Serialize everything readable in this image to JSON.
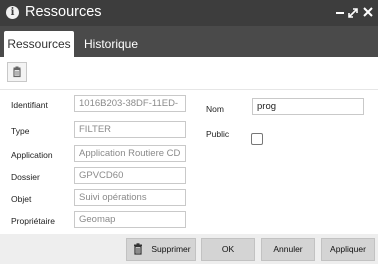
{
  "window": {
    "title": "Ressources"
  },
  "tabs": [
    {
      "label": "Ressources",
      "active": true
    },
    {
      "label": "Historique",
      "active": false
    }
  ],
  "fields": {
    "identifiant": {
      "label": "Identifiant",
      "value": "1016B203-38DF-11ED-"
    },
    "type": {
      "label": "Type",
      "value": "FILTER"
    },
    "application": {
      "label": "Application",
      "value": "Application Routiere CD"
    },
    "dossier": {
      "label": "Dossier",
      "value": "GPVCD60"
    },
    "objet": {
      "label": "Objet",
      "value": "Suivi opérations"
    },
    "proprietaire": {
      "label": "Propriétaire",
      "value": "Geomap"
    },
    "nom": {
      "label": "Nom",
      "value": "prog"
    },
    "public": {
      "label": "Public",
      "checked": false
    }
  },
  "footer": {
    "supprimer": "Supprimer",
    "ok": "OK",
    "annuler": "Annuler",
    "appliquer": "Appliquer"
  },
  "colors": {
    "titlebar": "#3d3d3d",
    "tabbar": "#4a4a4a",
    "button": "#d4d4d4"
  }
}
